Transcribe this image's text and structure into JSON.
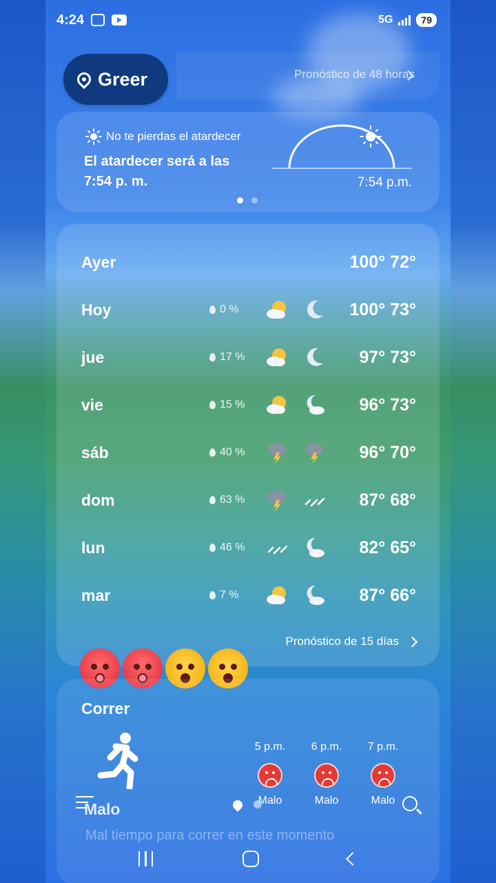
{
  "status_bar": {
    "time": "4:24",
    "network": "5G",
    "battery": "79"
  },
  "header": {
    "location": "Greer",
    "forecast_48h_link": "Pronóstico de 48 horas"
  },
  "sunset_card": {
    "alert": "No te pierdas el atardecer",
    "message": "El atardecer será a las 7:54 p. m.",
    "time_label": "7:54 p.m.",
    "page_count": 2,
    "active_page": 1
  },
  "forecast": {
    "rows": [
      {
        "day": "Ayer",
        "rain": "",
        "day_icon": "",
        "night_icon": "",
        "temps": "100° 72°"
      },
      {
        "day": "Hoy",
        "rain": "0 %",
        "day_icon": "partly-sunny-icon",
        "night_icon": "moon-icon",
        "temps": "100° 73°"
      },
      {
        "day": "jue",
        "rain": "17 %",
        "day_icon": "partly-sunny-icon",
        "night_icon": "moon-icon",
        "temps": "97° 73°"
      },
      {
        "day": "vie",
        "rain": "15 %",
        "day_icon": "partly-sunny-icon",
        "night_icon": "moon-cloud-icon",
        "temps": "96° 73°"
      },
      {
        "day": "sáb",
        "rain": "40 %",
        "day_icon": "thunderstorm-icon",
        "night_icon": "thunderstorm-icon",
        "temps": "96° 70°"
      },
      {
        "day": "dom",
        "rain": "63 %",
        "day_icon": "thunderstorm-icon",
        "night_icon": "rain-icon",
        "temps": "87° 68°"
      },
      {
        "day": "lun",
        "rain": "46 %",
        "day_icon": "rain-icon",
        "night_icon": "moon-cloud-icon",
        "temps": "82° 65°"
      },
      {
        "day": "mar",
        "rain": "7 %",
        "day_icon": "partly-sunny-icon",
        "night_icon": "moon-cloud-icon",
        "temps": "87° 66°"
      }
    ],
    "link_15_days": "Pronóstico de 15 días"
  },
  "emojis": [
    "hot-face-icon",
    "hot-face-icon",
    "exploding-head-icon",
    "exploding-head-icon"
  ],
  "running": {
    "title": "Correr",
    "hours": [
      {
        "time": "5 p.m.",
        "label": "Malo"
      },
      {
        "time": "6 p.m.",
        "label": "Malo"
      },
      {
        "time": "7 p.m.",
        "label": "Malo"
      }
    ],
    "status": "Malo",
    "description": "Mal tiempo para correr en este momento"
  },
  "colors": {
    "pill_bg": "#0f3a7f",
    "bad_indicator": "#e53935",
    "sun": "#f5c542"
  }
}
